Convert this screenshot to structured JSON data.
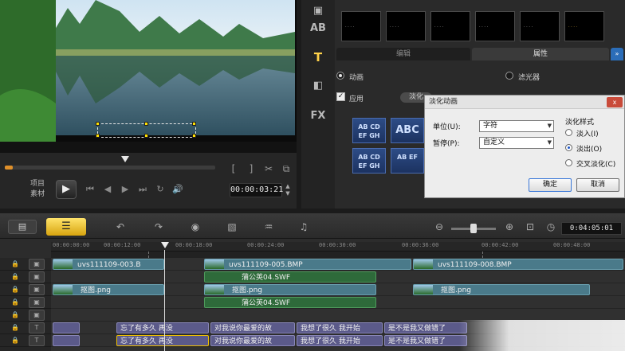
{
  "preview": {
    "caption_text": "",
    "mode_project": "项目",
    "mode_clip": "素材",
    "timecode": "00:00:03:21"
  },
  "library": {
    "side_icons": [
      "media-icon",
      "instant-project-icon",
      "title-icon",
      "transition-icon",
      "filter-icon"
    ],
    "side_icon_labels": {
      "title": "T",
      "filter": "FX",
      "instant": "AB"
    },
    "tabs": {
      "edit": "编辑",
      "attribute": "属性"
    },
    "options": {
      "animation": "动画",
      "filter": "滤光器",
      "apply": "应用",
      "fade": "淡化"
    },
    "anim_tiles": [
      {
        "text": "AB CD EF GH"
      },
      {
        "text": "ABC"
      },
      {
        "text": "AB CD EF GH"
      },
      {
        "text": "AB EF"
      }
    ]
  },
  "dialog": {
    "title": "淡化动画",
    "close": "x",
    "unit_label": "单位(U):",
    "unit_value": "字符",
    "pause_label": "暂停(P):",
    "pause_value": "自定义",
    "style_title": "淡化样式",
    "styles": [
      {
        "label": "淡入(I)",
        "checked": false
      },
      {
        "label": "淡出(O)",
        "checked": true
      },
      {
        "label": "交叉淡化(C)",
        "checked": false
      }
    ],
    "ok": "确定",
    "cancel": "取消"
  },
  "timeline": {
    "project_duration": "0:04:05:01",
    "ruler": [
      "00:00:00:00",
      "00:00:12:00",
      "00:00:18:00",
      "00:00:24:00",
      "00:00:30:00",
      "00:00:36:00",
      "00:00:42:00",
      "00:00:48:00"
    ],
    "clips": {
      "video1": "uvs111109-003.B",
      "video2": "uvs111109-005.BMP",
      "video3": "uvs111109-008.BMP",
      "overlay1": "蒲公英04.SWF",
      "pic1": "抠图.png",
      "pic2": "抠图.png",
      "pic3": "抠图.png",
      "overlay2": "蒲公英04.SWF"
    },
    "title_row1": [
      "忘了有多久 再没",
      "对我说你最爱的故",
      "我想了很久 我开始",
      "是不是我又做错了"
    ],
    "title_row2": [
      "忘了有多久 再没",
      "对我说你最爱的故",
      "我想了很久 我开始",
      "是不是我又做错了"
    ]
  }
}
